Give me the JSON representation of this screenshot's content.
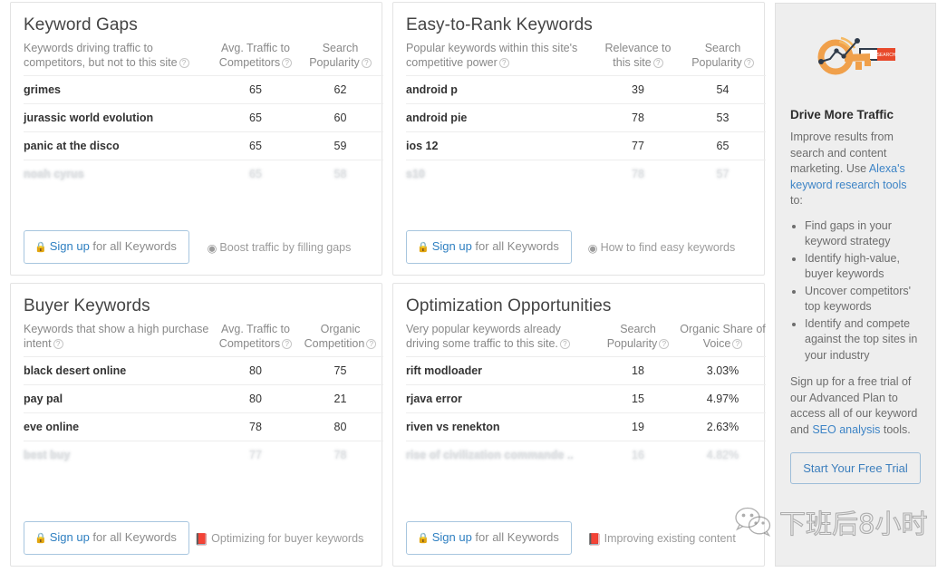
{
  "cards": [
    {
      "id": "keyword-gaps",
      "title": "Keyword Gaps",
      "description": "Keywords driving traffic to competitors, but not to this site",
      "columns": [
        "Avg. Traffic to Competitors",
        "Search Popularity"
      ],
      "rows": [
        {
          "name": "grimes",
          "v1": "65",
          "v2": "62",
          "locked": false
        },
        {
          "name": "jurassic world evolution",
          "v1": "65",
          "v2": "60",
          "locked": false
        },
        {
          "name": "panic at the disco",
          "v1": "65",
          "v2": "59",
          "locked": false
        },
        {
          "name": "noah cyrus",
          "v1": "65",
          "v2": "58",
          "locked": true
        }
      ],
      "signup_lock": "🔒",
      "signup_highlight": "Sign up",
      "signup_rest": " for all Keywords",
      "footer_icon": "play-circle-icon",
      "footer_glyph": "◉",
      "footer_label": "Boost traffic by filling gaps"
    },
    {
      "id": "easy-to-rank-keywords",
      "title": "Easy-to-Rank Keywords",
      "description": "Popular keywords within this site's competitive power",
      "columns": [
        "Relevance to this site",
        "Search Popularity"
      ],
      "rows": [
        {
          "name": "android p",
          "v1": "39",
          "v2": "54",
          "locked": false
        },
        {
          "name": "android pie",
          "v1": "78",
          "v2": "53",
          "locked": false
        },
        {
          "name": "ios 12",
          "v1": "77",
          "v2": "65",
          "locked": false
        },
        {
          "name": "s10",
          "v1": "78",
          "v2": "57",
          "locked": true
        }
      ],
      "signup_lock": "🔒",
      "signup_highlight": "Sign up",
      "signup_rest": " for all Keywords",
      "footer_icon": "play-circle-icon",
      "footer_glyph": "◉",
      "footer_label": "How to find easy keywords"
    },
    {
      "id": "buyer-keywords",
      "title": "Buyer Keywords",
      "description": "Keywords that show a high purchase intent",
      "columns": [
        "Avg. Traffic to Competitors",
        "Organic Competition"
      ],
      "rows": [
        {
          "name": "black desert online",
          "v1": "80",
          "v2": "75",
          "locked": false
        },
        {
          "name": "pay pal",
          "v1": "80",
          "v2": "21",
          "locked": false
        },
        {
          "name": "eve online",
          "v1": "78",
          "v2": "80",
          "locked": false
        },
        {
          "name": "best buy",
          "v1": "77",
          "v2": "78",
          "locked": true
        }
      ],
      "signup_lock": "🔒",
      "signup_highlight": "Sign up",
      "signup_rest": " for all Keywords",
      "footer_icon": "book-icon",
      "footer_glyph": "📕",
      "footer_label": "Optimizing for buyer keywords"
    },
    {
      "id": "optimization-opportunities",
      "title": "Optimization Opportunities",
      "description": "Very popular keywords already driving some traffic to this site.",
      "columns": [
        "Search Popularity",
        "Organic Share of Voice"
      ],
      "rows": [
        {
          "name": "rift modloader",
          "v1": "18",
          "v2": "3.03%",
          "locked": false
        },
        {
          "name": "rjava error",
          "v1": "15",
          "v2": "4.97%",
          "locked": false
        },
        {
          "name": "riven vs renekton",
          "v1": "19",
          "v2": "2.63%",
          "locked": false
        },
        {
          "name": "rise of civilization commande ..",
          "v1": "16",
          "v2": "4.82%",
          "locked": true
        }
      ],
      "signup_lock": "🔒",
      "signup_highlight": "Sign up",
      "signup_rest": " for all Keywords",
      "footer_icon": "book-icon",
      "footer_glyph": "📕",
      "footer_label": "Improving existing content"
    }
  ],
  "help_glyph": "?",
  "sidebar": {
    "art_icon": "key-search-icon",
    "art_badge_label": "SEARCH",
    "heading": "Drive More Traffic",
    "paragraph_part1": "Improve results from search and content marketing. Use ",
    "paragraph_link": "Alexa's keyword research tools",
    "paragraph_part2": " to:",
    "bullets": [
      "Find gaps in your keyword strategy",
      "Identify high-value, buyer keywords",
      "Uncover competitors' top keywords",
      "Identify and compete against the top sites in your industry"
    ],
    "closing_part1": "Sign up for a free trial of our Advanced Plan to access all of our keyword and ",
    "closing_link": "SEO analysis",
    "closing_part2": " tools.",
    "trial_button": "Start Your Free Trial"
  },
  "watermark": {
    "icon": "wechat-icon",
    "text": "下班后8小时"
  },
  "colors": {
    "link": "#3d84c6",
    "card_border": "#e3e3e3",
    "sidebar_bg": "#eeeeee",
    "accent_orange": "#F0A04B",
    "accent_red": "#E8492B"
  }
}
